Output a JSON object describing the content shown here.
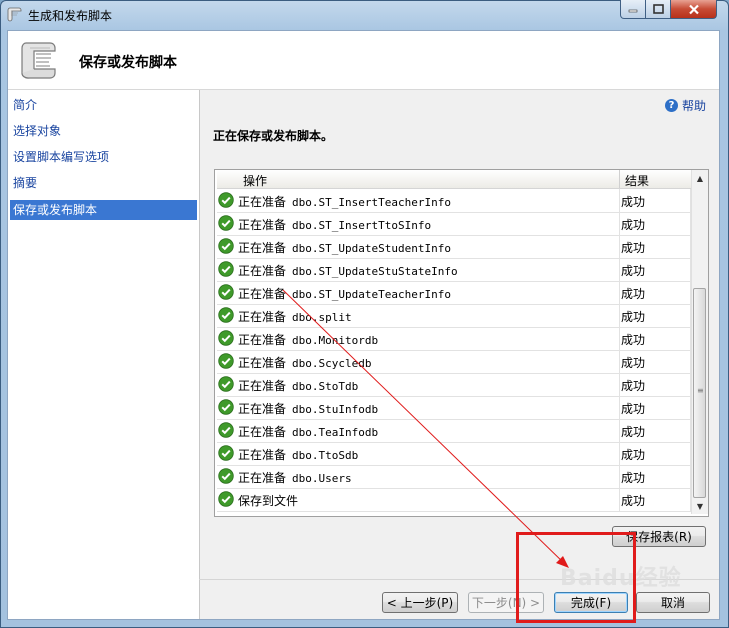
{
  "window": {
    "title": "生成和发布脚本",
    "minimize_glyph": "–",
    "maximize_glyph": "□",
    "close_glyph": "✕"
  },
  "header": {
    "title": "保存或发布脚本",
    "icon": "scroll-icon"
  },
  "nav": {
    "items": [
      {
        "label": "简介",
        "selected": false
      },
      {
        "label": "选择对象",
        "selected": false
      },
      {
        "label": "设置脚本编写选项",
        "selected": false
      },
      {
        "label": "摘要",
        "selected": false
      },
      {
        "label": "保存或发布脚本",
        "selected": true
      }
    ]
  },
  "help": {
    "label": "帮助",
    "icon": "help-icon"
  },
  "main": {
    "status": "正在保存或发布脚本。"
  },
  "grid": {
    "columns": [
      "操作",
      "结果"
    ],
    "rows": [
      {
        "op": "正在准备",
        "obj": "dbo.ST_InsertTeacherInfo",
        "result": "成功"
      },
      {
        "op": "正在准备",
        "obj": "dbo.ST_InsertTtoSInfo",
        "result": "成功"
      },
      {
        "op": "正在准备",
        "obj": "dbo.ST_UpdateStudentInfo",
        "result": "成功"
      },
      {
        "op": "正在准备",
        "obj": "dbo.ST_UpdateStuStateInfo",
        "result": "成功"
      },
      {
        "op": "正在准备",
        "obj": "dbo.ST_UpdateTeacherInfo",
        "result": "成功"
      },
      {
        "op": "正在准备",
        "obj": "dbo.split",
        "result": "成功"
      },
      {
        "op": "正在准备",
        "obj": "dbo.Monitordb",
        "result": "成功"
      },
      {
        "op": "正在准备",
        "obj": "dbo.Scycledb",
        "result": "成功"
      },
      {
        "op": "正在准备",
        "obj": "dbo.StoTdb",
        "result": "成功"
      },
      {
        "op": "正在准备",
        "obj": "dbo.StuInfodb",
        "result": "成功"
      },
      {
        "op": "正在准备",
        "obj": "dbo.TeaInfodb",
        "result": "成功"
      },
      {
        "op": "正在准备",
        "obj": "dbo.TtoSdb",
        "result": "成功"
      },
      {
        "op": "正在准备",
        "obj": "dbo.Users",
        "result": "成功"
      },
      {
        "op": "保存到文件",
        "obj": "",
        "result": "成功"
      }
    ],
    "status_icon": "check-icon",
    "success_color": "#3f9a2a"
  },
  "buttons": {
    "save_report": "保存报表(R)",
    "back": "< 上一步(P)",
    "next": "下一步(N) >",
    "finish": "完成(F)",
    "cancel": "取消"
  },
  "annotation": {
    "color": "#e01b1b"
  },
  "watermark": {
    "text": "Baidu经验"
  }
}
